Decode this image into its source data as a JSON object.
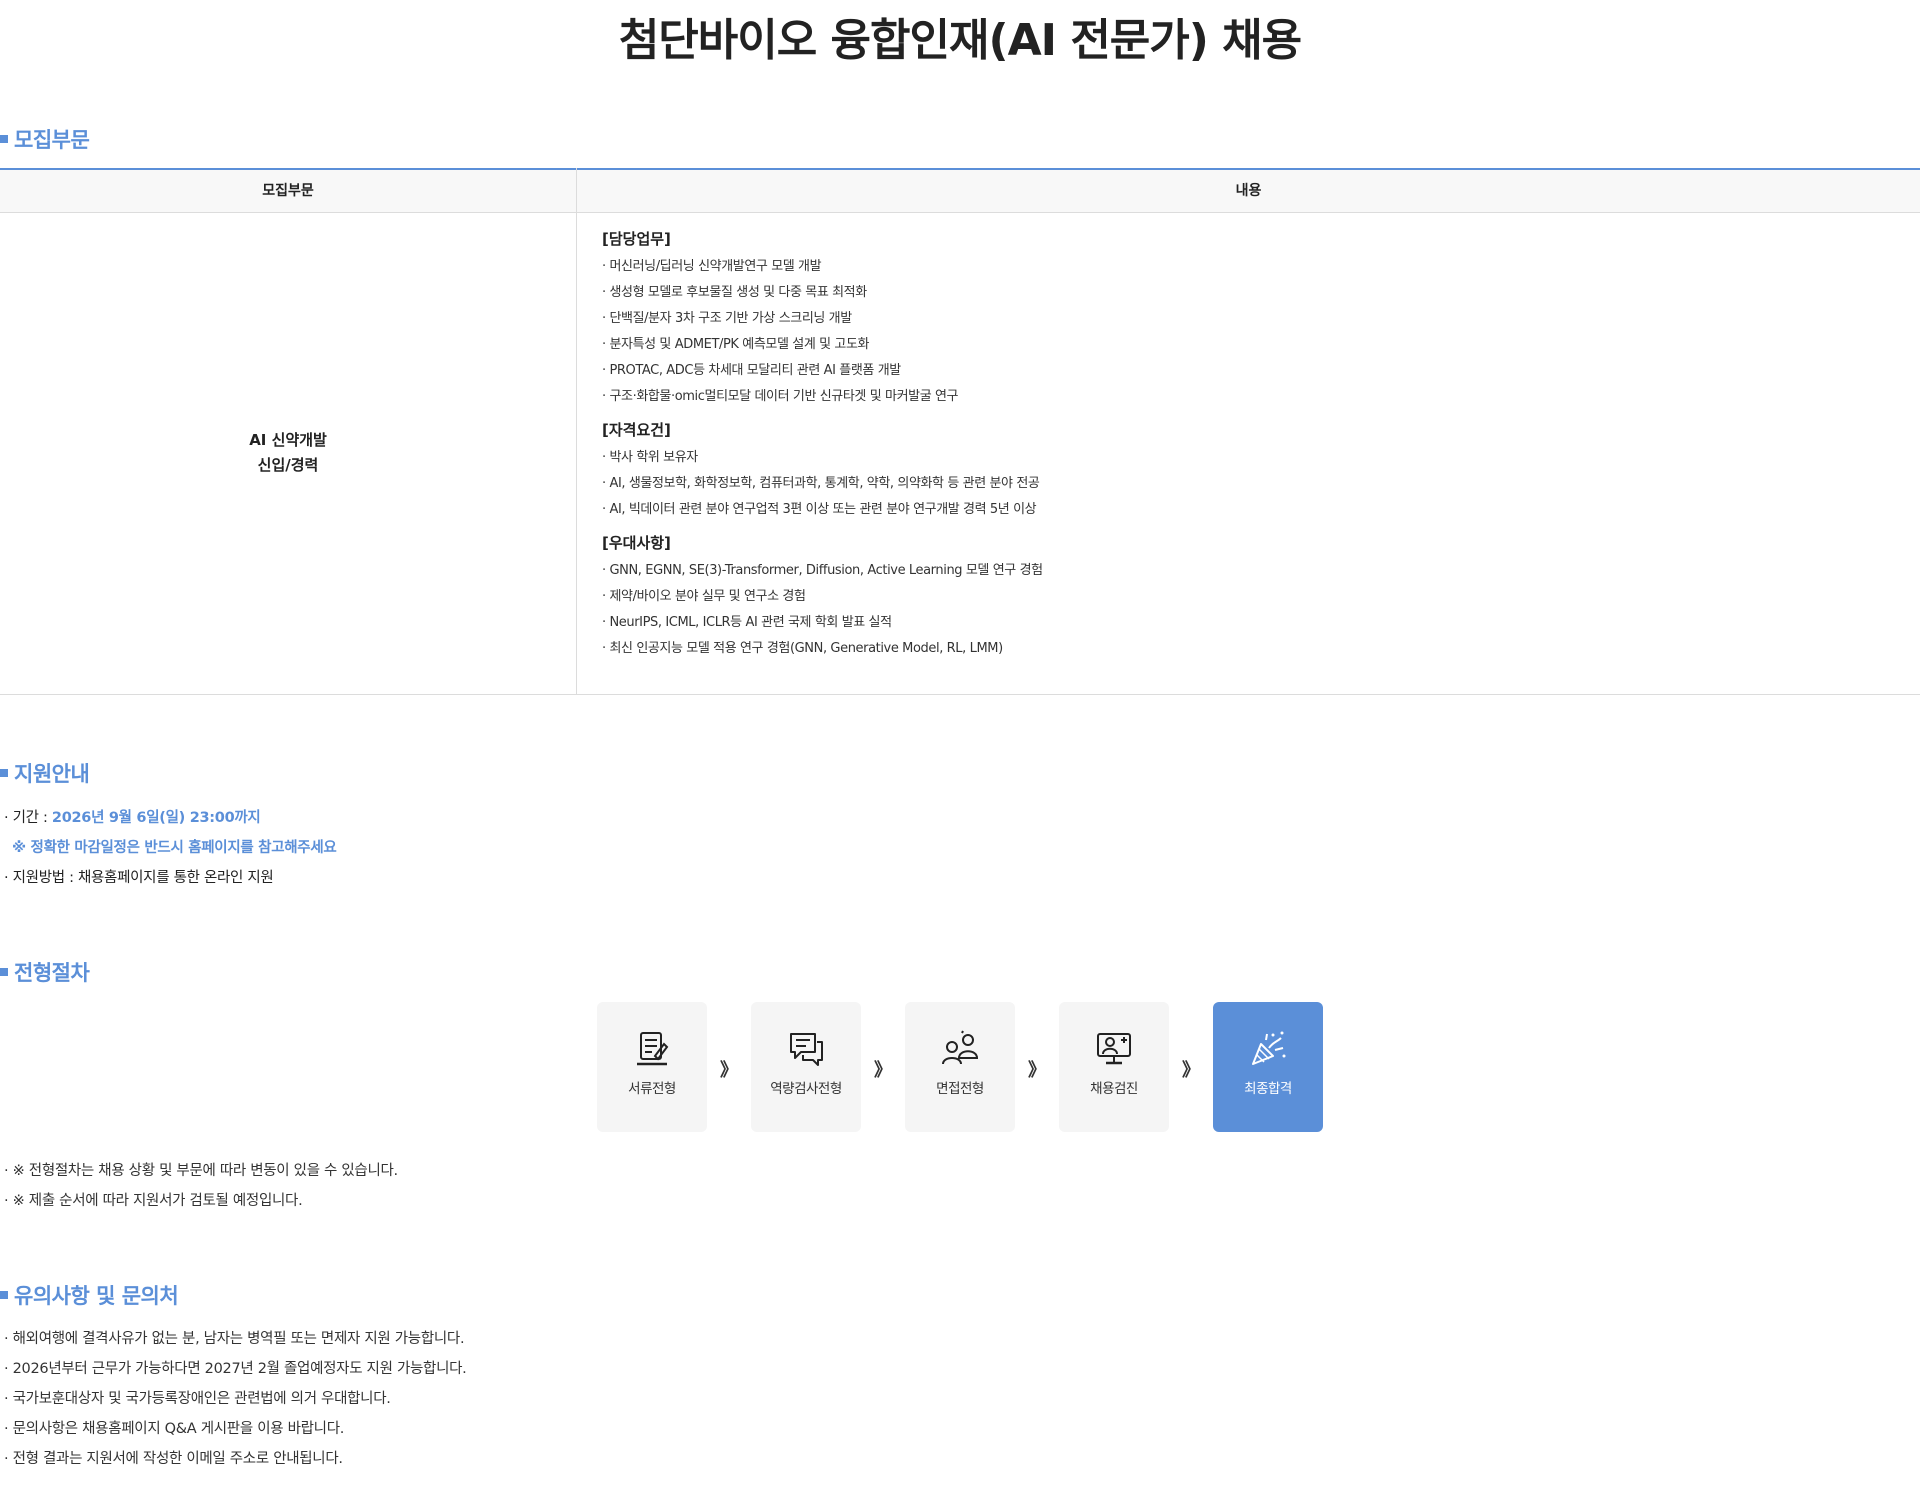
{
  "page": {
    "title": "첨단바이오 융합인재(AI 전문가) 채용"
  },
  "sections": {
    "recruit": "모집부문",
    "apply": "지원안내",
    "process": "전형절차",
    "notice": "유의사항 및 문의처"
  },
  "table": {
    "headers": [
      "모집부문",
      "내용"
    ],
    "category": [
      "AI 신약개발",
      "신입/경력"
    ],
    "groups": [
      {
        "title": "[담당업무]",
        "items": [
          "· 머신러닝/딥러닝 신약개발연구 모델 개발",
          "· 생성형 모델로 후보물질 생성 및 다중 목표 최적화",
          "· 단백질/분자 3차 구조 기반 가상 스크리닝 개발",
          "· 분자특성 및 ADMET/PK 예측모델 설계 및 고도화",
          "· PROTAC, ADC등 차세대 모달리티 관련 AI 플랫폼 개발",
          "· 구조·화합물·omic멀티모달 데이터 기반 신규타겟 및 마커발굴 연구"
        ]
      },
      {
        "title": "[자격요건]",
        "items": [
          "· 박사 학위 보유자",
          "· AI, 생물정보학, 화학정보학, 컴퓨터과학, 통계학, 약학, 의약화학 등 관련 분야 전공",
          "· AI, 빅데이터 관련 분야 연구업적 3편 이상 또는 관련 분야 연구개발 경력 5년 이상"
        ]
      },
      {
        "title": "[우대사항]",
        "items": [
          "· GNN, EGNN, SE(3)-Transformer, Diffusion, Active Learning 모델 연구 경험",
          "· 제약/바이오 분야 실무 및 연구소 경험",
          "· NeurIPS, ICML, ICLR등 AI 관련 국제 학회 발표 실적",
          "· 최신 인공지능 모델 적용 연구 경험(GNN, Generative Model, RL, LMM)"
        ]
      }
    ]
  },
  "apply": {
    "period_label": "· 기간 : ",
    "period_value": "2026년 9월 6일(일) 23:00까지",
    "period_note": "※ 정확한 마감일정은 반드시 홈페이지를 참고해주세요",
    "method": "· 지원방법 : 채용홈페이지를 통한 온라인 지원"
  },
  "process": {
    "arrow": "》",
    "steps": [
      {
        "label": "서류전형",
        "icon": "document-icon"
      },
      {
        "label": "역량검사전형",
        "icon": "chat-icon"
      },
      {
        "label": "면접전형",
        "icon": "people-icon"
      },
      {
        "label": "채용검진",
        "icon": "monitor-doctor-icon"
      },
      {
        "label": "최종합격",
        "icon": "party-popper-icon"
      }
    ],
    "notes": [
      "· ※ 전형절차는 채용 상황 및 부문에 따라 변동이 있을 수 있습니다.",
      "· ※ 제출 순서에 따라 지원서가 검토될 예정입니다."
    ]
  },
  "notice": {
    "items": [
      "· 해외여행에 결격사유가 없는 분, 남자는 병역필 또는 면제자 지원 가능합니다.",
      "· 2026년부터 근무가 가능하다면 2027년 2월 졸업예정자도 지원 가능합니다.",
      "· 국가보훈대상자 및 국가등록장애인은 관련법에 의거 우대합니다.",
      "· 문의사항은 채용홈페이지 Q&A 게시판을 이용 바랍니다.",
      "· 전형 결과는 지원서에 작성한 이메일 주소로 안내됩니다."
    ]
  },
  "colors": {
    "accent": "#5b8fd8",
    "text": "#222222",
    "step_bg": "#f5f5f5",
    "border": "#dcdcdc"
  }
}
